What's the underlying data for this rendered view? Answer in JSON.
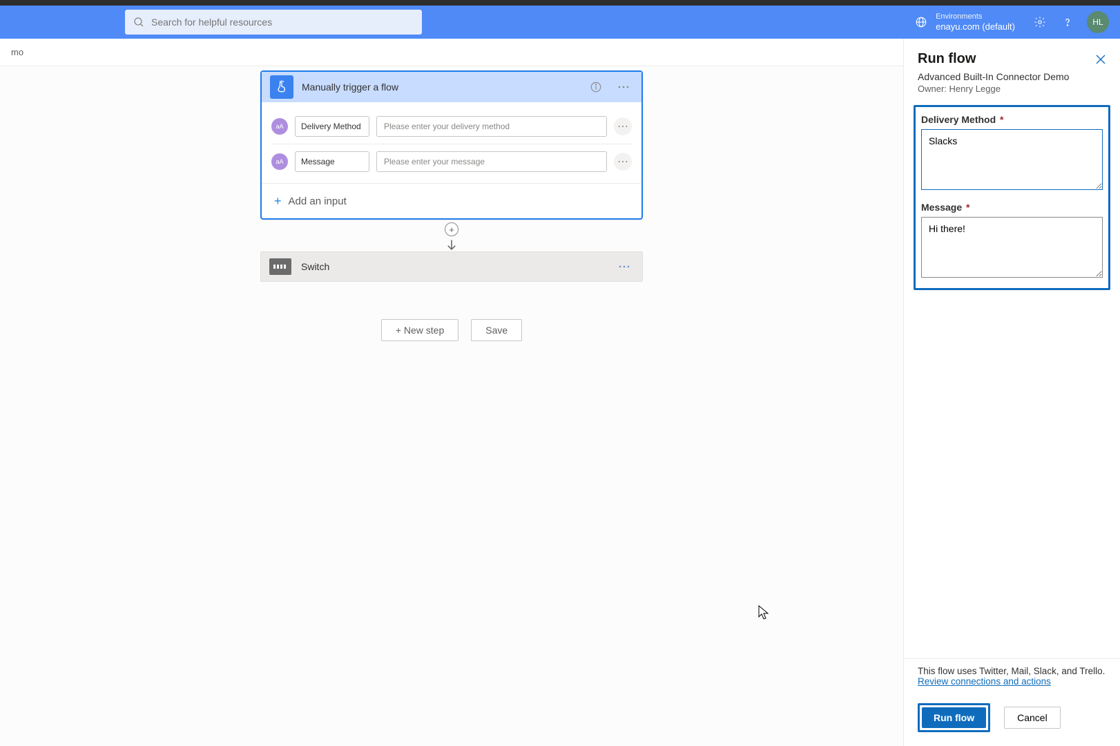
{
  "header": {
    "search_placeholder": "Search for helpful resources",
    "env_label": "Environments",
    "env_name": "enayu.com (default)",
    "avatar_initials": "HL"
  },
  "breadcrumb": "mo",
  "trigger": {
    "title": "Manually trigger a flow",
    "params": [
      {
        "badge": "aA",
        "name": "Delivery Method",
        "placeholder": "Please enter your delivery method"
      },
      {
        "badge": "aA",
        "name": "Message",
        "placeholder": "Please enter your message"
      }
    ],
    "add_input": "Add an input"
  },
  "switch_step": {
    "title": "Switch"
  },
  "bottom": {
    "new_step": "+ New step",
    "save": "Save"
  },
  "panel": {
    "title": "Run flow",
    "subtitle": "Advanced Built-In Connector Demo",
    "owner": "Owner: Henry Legge",
    "fields": [
      {
        "label": "Delivery Method",
        "required": true,
        "value": "Slacks"
      },
      {
        "label": "Message",
        "required": true,
        "value": "Hi there!"
      }
    ],
    "note": "This flow uses Twitter, Mail, Slack, and Trello.",
    "link": "Review connections and actions",
    "run": "Run flow",
    "cancel": "Cancel"
  }
}
